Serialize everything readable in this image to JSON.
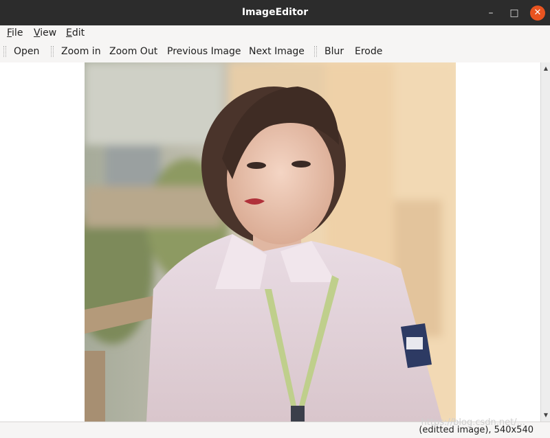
{
  "window": {
    "title": "ImageEditor"
  },
  "window_controls": {
    "minimize": "–",
    "maximize": "□",
    "close": "✕"
  },
  "menu": [
    {
      "mnemonic": "F",
      "rest": "ile"
    },
    {
      "mnemonic": "V",
      "rest": "iew"
    },
    {
      "mnemonic": "E",
      "rest": "dit"
    }
  ],
  "toolbar": {
    "open": "Open",
    "zoom_in": "Zoom in",
    "zoom_out": "Zoom Out",
    "previous_image": "Previous Image",
    "next_image": "Next Image",
    "blur": "Blur",
    "erode": "Erode"
  },
  "scrollbar": {
    "up": "▲",
    "down": "▼"
  },
  "status": {
    "text": "(editted image), 540x540"
  },
  "watermark": "https://blog.csdn.net/..."
}
